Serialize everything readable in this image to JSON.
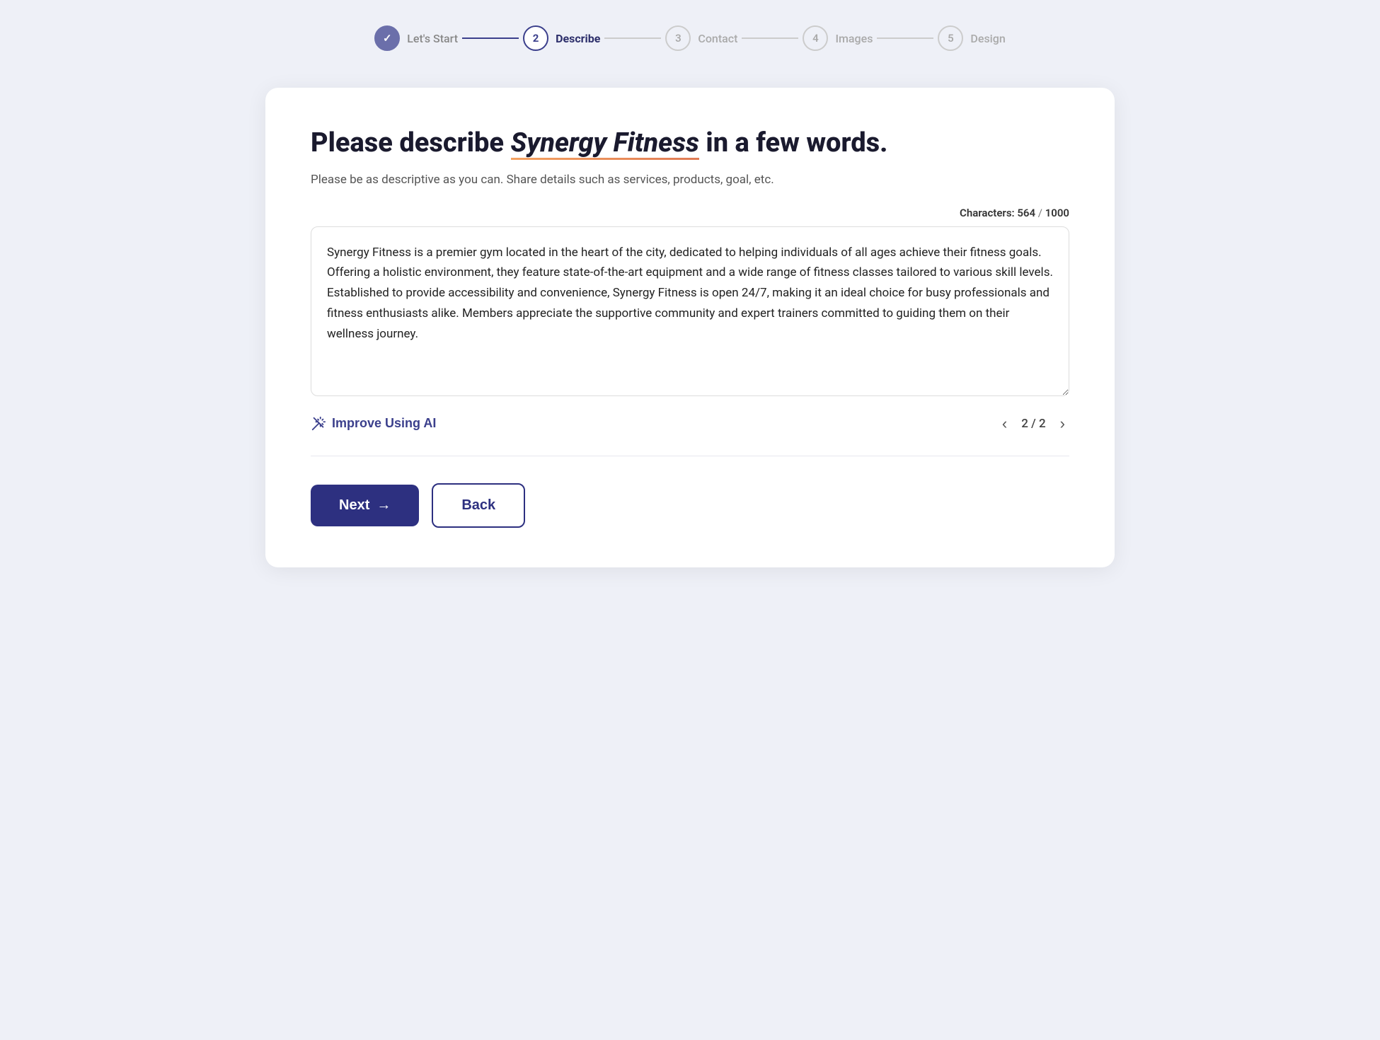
{
  "stepper": {
    "steps": [
      {
        "id": "lets-start",
        "number": "✓",
        "label": "Let's Start",
        "state": "done"
      },
      {
        "id": "describe",
        "number": "2",
        "label": "Describe",
        "state": "active"
      },
      {
        "id": "contact",
        "number": "3",
        "label": "Contact",
        "state": "inactive"
      },
      {
        "id": "images",
        "number": "4",
        "label": "Images",
        "state": "inactive"
      },
      {
        "id": "design",
        "number": "5",
        "label": "Design",
        "state": "inactive"
      }
    ],
    "connector_done_indices": [
      0
    ]
  },
  "card": {
    "title_before": "Please describe ",
    "title_brand": "Synergy Fitness",
    "title_after": " in a few words.",
    "subtitle": "Please be as descriptive as you can. Share details such as services, products, goal, etc.",
    "char_label": "Characters:",
    "char_current": "564",
    "char_max": "1000",
    "textarea_value": "Synergy Fitness is a premier gym located in the heart of the city, dedicated to helping individuals of all ages achieve their fitness goals. Offering a holistic environment, they feature state-of-the-art equipment and a wide range of fitness classes tailored to various skill levels. Established to provide accessibility and convenience, Synergy Fitness is open 24/7, making it an ideal choice for busy professionals and fitness enthusiasts alike. Members appreciate the supportive community and expert trainers committed to guiding them on their wellness journey.",
    "improve_ai_label": "Improve Using AI",
    "pagination_current": "2",
    "pagination_total": "2",
    "btn_next_label": "Next",
    "btn_back_label": "Back"
  }
}
